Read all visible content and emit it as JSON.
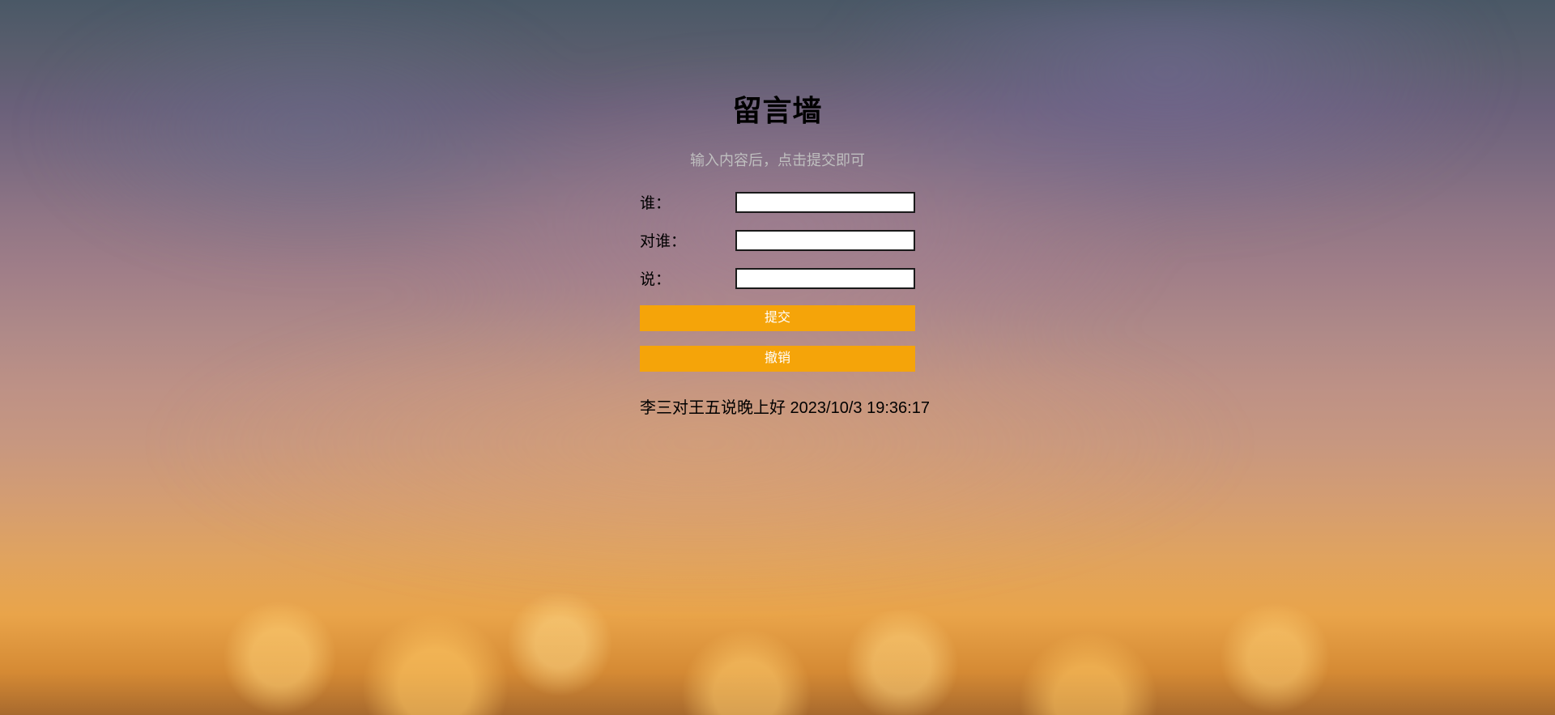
{
  "header": {
    "title": "留言墙",
    "subtitle": "输入内容后，点击提交即可"
  },
  "form": {
    "who_label": "谁：",
    "to_label": "对谁：",
    "say_label": "说：",
    "who_value": "",
    "to_value": "",
    "say_value": ""
  },
  "buttons": {
    "submit": "提交",
    "undo": "撤销"
  },
  "messages": [
    "李三对王五说晚上好 2023/10/3 19:36:17"
  ]
}
